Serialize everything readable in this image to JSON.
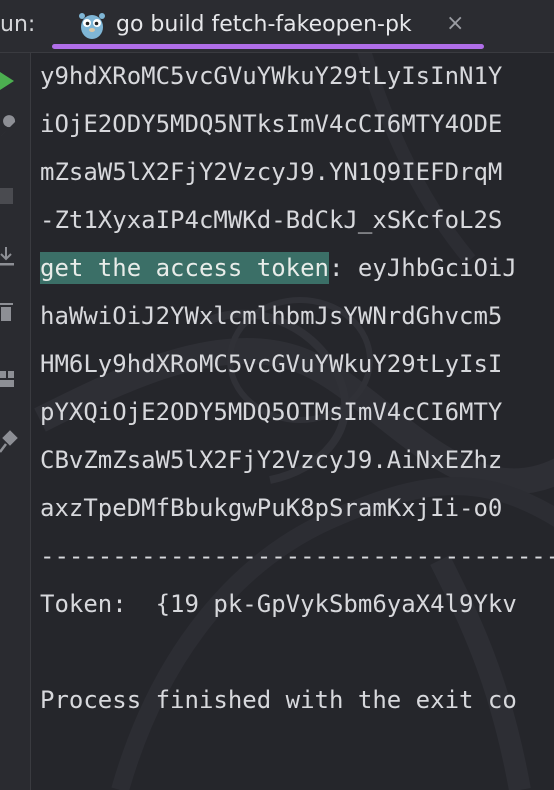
{
  "run": {
    "label": "un:"
  },
  "tab": {
    "title": "go build fetch-fakeopen-pk",
    "close_glyph": "×",
    "icon": "go-gopher-icon",
    "accent": "#b06ee8"
  },
  "toolbar": {
    "icons": [
      "run-icon",
      "wrench-icon",
      "stop-icon",
      "download-icon",
      "trash-icon",
      "layout-icon",
      "pin-icon"
    ],
    "run_color": "#4caf50"
  },
  "console": {
    "lines": [
      "y9hdXRoMC5vcGVuYWkuY29tLyIsInN1Y",
      "iOjE2ODY5MDQ5NTksImV4cCI6MTY4ODE",
      "mZsaW5lX2FjY2VzcyJ9.YN1Q9IEFDrqM",
      "-Zt1XyxaIP4cMWKd-BdCkJ_xSKcfoL2S",
      "",
      "haWwiOiJ2YWxlcmlhbmJsYWNrdGhvcm5",
      "HM6Ly9hdXRoMC5vcGVuYWkuY29tLyIsI",
      "pYXQiOjE2ODY5MDQ5OTMsImV4cCI6MTY",
      "CBvZmZsaW5lX2FjY2VzcyJ9.AiNxEZhz",
      "axzTpeDMfBbukgwPuK8pSramKxjIi-o0",
      "------------------------------------",
      "Token:  {19 pk-GpVykSbm6yaX4l9Ykv",
      "",
      "Process finished with the exit co"
    ],
    "access_prefix": "get the access token",
    "access_rest": ": eyJhbGciOiJ",
    "highlight_color": "#3b6f67"
  }
}
